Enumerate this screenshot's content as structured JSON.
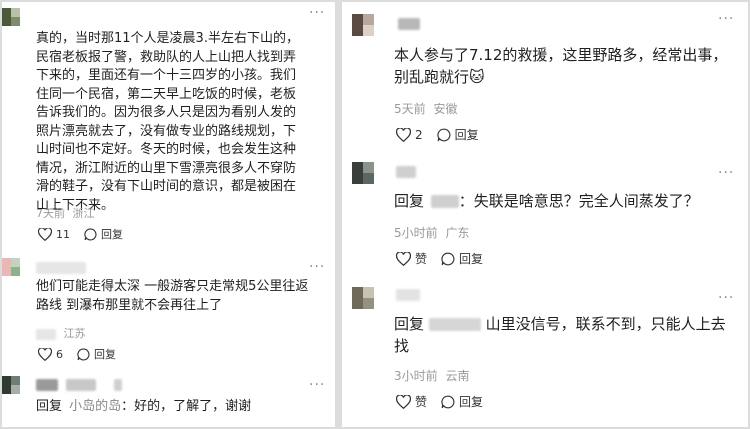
{
  "left": {
    "comments": [
      {
        "text": "真的，当时那11个人是凌晨3.半左右下山的，民宿老板报了警，救助队的人上山把人找到弄下来的，里面还有一个十三四岁的小孩。我们住同一个民宿，第二天早上吃饭的时候，老板告诉我们的。因为很多人只是因为看别人发的照片漂亮就去了，没有做专业的路线规划，下山时间也不定好。冬天的时候，也会发生这种情况，浙江附近的山里下雪漂亮很多人不穿防滑的鞋子，没有下山时间的意识，都是被困在山上下不来。",
        "time": "7天前",
        "location": "浙江",
        "likes": "11",
        "reply_label": "回复"
      },
      {
        "text": "他们可能走得太深 一般游客只走常规5公里往返路线 到瀑布那里就不会再往上了",
        "time": "",
        "location": "江苏",
        "likes": "6",
        "reply_label": "回复"
      },
      {
        "reply_prefix": "回复",
        "reply_to": "小岛的岛",
        "text": "：好的，了解了，谢谢"
      }
    ]
  },
  "right": {
    "comments": [
      {
        "text": "本人参与了7.12的救援，这里野路多，经常出事，别乱跑就行",
        "emoji": "🐱",
        "time": "5天前",
        "location": "安徽",
        "likes": "2",
        "reply_label": "回复"
      },
      {
        "reply_prefix": "回复",
        "text": "：失联是啥意思？完全人间蒸发了？",
        "time": "5小时前",
        "location": "广东",
        "likes": "赞",
        "reply_label": "回复"
      },
      {
        "reply_prefix": "回复",
        "text": "山里没信号，联系不到，只能人上去找",
        "time": "3小时前",
        "location": "云南",
        "likes": "赞",
        "reply_label": "回复"
      }
    ]
  },
  "icons": {
    "more": "more-dots-icon",
    "like": "heart-icon",
    "reply": "comment-bubble-icon"
  },
  "colors": {
    "text": "#1f1f1f",
    "meta": "#9a9a9a",
    "background": "#ffffff",
    "divider": "#dcdcdc"
  }
}
